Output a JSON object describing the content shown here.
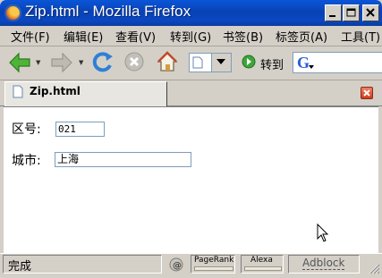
{
  "window": {
    "title": "Zip.html - Mozilla Firefox"
  },
  "menubar": {
    "items": [
      {
        "label": "文件(F)"
      },
      {
        "label": "编辑(E)"
      },
      {
        "label": "查看(V)"
      },
      {
        "label": "转到(G)"
      },
      {
        "label": "书签(B)"
      },
      {
        "label": "标签页(A)"
      },
      {
        "label": "工具(T)"
      }
    ]
  },
  "toolbar": {
    "back_icon": "green-left-arrow-icon",
    "forward_icon": "gray-right-arrow-icon",
    "reload_icon": "blue-reload-icon",
    "stop_icon": "gray-stop-icon",
    "home_icon": "home-icon",
    "go_label": "转到",
    "search_engine_icon": "google-icon"
  },
  "tabs": [
    {
      "label": "Zip.html",
      "active": true
    }
  ],
  "form": {
    "zip_label": "区号:",
    "zip_value": "021",
    "city_label": "城市:",
    "city_value": "上海"
  },
  "statusbar": {
    "status_text": "完成",
    "pagerank_label": "PageRank",
    "alexa_label": "Alexa",
    "adblock_label": "Adblock"
  },
  "colors": {
    "titlebar": "#0842b5",
    "chrome": "#d4d0c8",
    "content_bg": "#ffffff",
    "input_border": "#7f9db9"
  }
}
